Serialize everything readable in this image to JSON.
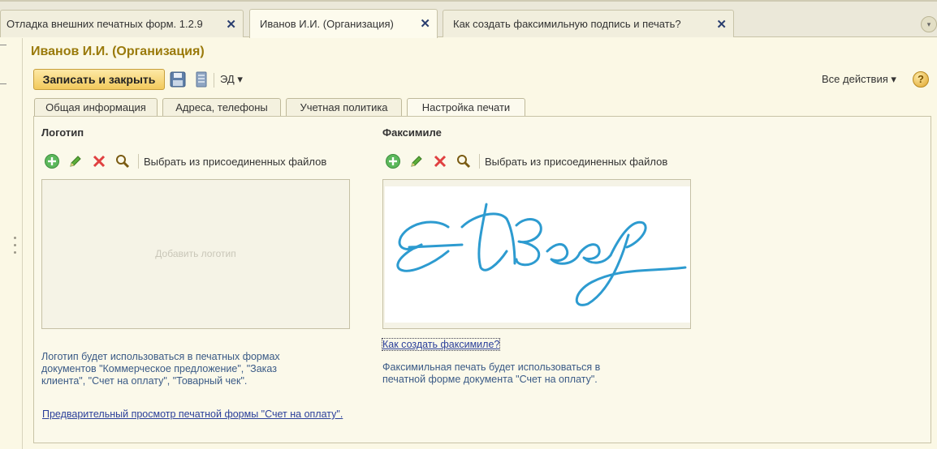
{
  "window_tabs": [
    {
      "label": "Отладка внешних печатных форм. 1.2.9",
      "active": false
    },
    {
      "label": "Иванов И.И. (Организация)",
      "active": true
    },
    {
      "label": "Как создать факсимильную подпись и печать?",
      "active": false
    }
  ],
  "tab_close_symbol": "✕",
  "form": {
    "title": "Иванов И.И. (Организация)",
    "toolbar": {
      "save_close_label": "Записать и закрыть",
      "save_icon": "floppy-disk-icon",
      "list_icon": "document-list-icon",
      "ed_label": "ЭД ▾",
      "all_actions_label": "Все действия ▾",
      "help_label": "?"
    },
    "tabs": [
      {
        "label": "Общая информация",
        "active": false
      },
      {
        "label": "Адреса, телефоны",
        "active": false
      },
      {
        "label": "Учетная политика",
        "active": false
      },
      {
        "label": "Настройка печати",
        "active": true
      }
    ],
    "logo": {
      "title": "Логотип",
      "select_label": "Выбрать из присоединенных файлов",
      "placeholder": "Добавить логотип",
      "note": [
        "Логотип будет использоваться в печатных формах",
        "документов \"Коммерческое предложение\", \"Заказ",
        "клиента\", \"Счет на оплату\", \"Товарный чек\"."
      ],
      "preview_link": "Предварительный просмотр печатной формы \"Счет на оплату\"."
    },
    "facsimile": {
      "title": "Факсимиле",
      "select_label": "Выбрать  из присоединенных файлов",
      "howto_link": "Как создать факсимиле?",
      "note": [
        "Факсимильная печать будет использоваться в",
        "печатной форме документа \"Счет на оплату\"."
      ]
    }
  },
  "colors": {
    "title": "#9a7a0b",
    "note": "#3a5a86",
    "link": "#2a3f9a",
    "signature": "#2d9bd0",
    "add": "#4aa84a",
    "delete": "#e04040"
  }
}
